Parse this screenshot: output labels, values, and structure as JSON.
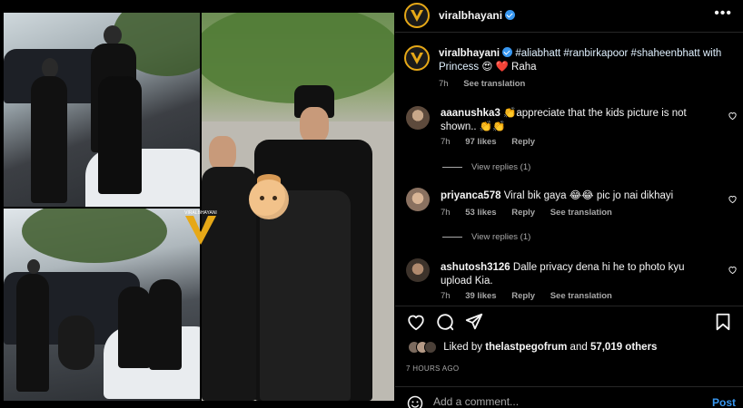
{
  "header": {
    "username": "viralbhayani",
    "more_label": "•••"
  },
  "media": {
    "watermark_text": "VIRALBHAYANI"
  },
  "caption": {
    "username": "viralbhayani",
    "text_part1": "#aliabhatt #ranbirkapoor #shaheenbhatt with Princess",
    "emoji1": "😍",
    "heart": "❤️",
    "text_part2": "Raha",
    "time": "7h",
    "see_translation": "See translation"
  },
  "comments": [
    {
      "username": "aaanushka3",
      "emoji_lead": "👏",
      "text": "appreciate that the kids picture is not shown..",
      "emoji_tail": "👏👏",
      "time": "7h",
      "likes": "97 likes",
      "reply": "Reply",
      "view_replies": "View replies (1)"
    },
    {
      "username": "priyanca578",
      "text": "Viral bik gaya",
      "emoji_mid": "😂😂",
      "text2": "pic jo nai dikhayi",
      "time": "7h",
      "likes": "53 likes",
      "reply": "Reply",
      "see_translation": "See translation",
      "view_replies": "View replies (1)"
    },
    {
      "username": "ashutosh3126",
      "text": "Dalle privacy dena hi he to photo kyu upload Kia.",
      "time": "7h",
      "likes": "39 likes",
      "reply": "Reply",
      "see_translation": "See translation"
    }
  ],
  "likes": {
    "prefix": "Liked by",
    "user": "thelastpegofrum",
    "and": "and",
    "count": "57,019 others"
  },
  "posted_ago": "7 HOURS AGO",
  "comment_box": {
    "placeholder": "Add a comment...",
    "post_label": "Post"
  },
  "colors": {
    "accent": "#3897f0",
    "like_red": "#ed4956",
    "brand_gold": "#e6a817"
  }
}
